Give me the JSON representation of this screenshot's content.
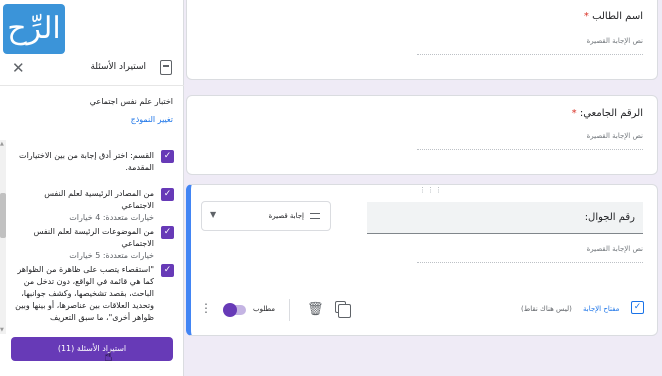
{
  "logo": {
    "text": "الرِّح"
  },
  "import_panel": {
    "title": "استيراد الأسئلة",
    "source_form": "اختبار علم نفس اجتماعي",
    "change_form_link": "تغيير النموذج",
    "questions": [
      {
        "text": "القسم: اختر أدق إجابة من بين الاختيارات المقدمة.",
        "sub": "",
        "checked": true
      },
      {
        "text": "من المصادر الرئيسية لعلم النفس الاجتماعي",
        "sub": "خيارات متعددة: 4 خيارات",
        "checked": true
      },
      {
        "text": "من الموضوعات الرئيسة لعلم النفس الاجتماعي",
        "sub": "خيارات متعددة: 5 خيارات",
        "checked": true
      },
      {
        "text": "\"استقصاء يتصب على ظاهرة من الظواهر كما هي قائمة في الواقع، دون تدخل من الباحث، بقصد تشخيصها، وكشف جوانبها، وتحديد العلاقات بين عناصرها، أو بينها وبين ظواهر أخرى\"، ما سبق التعريف",
        "sub": "",
        "checked": true
      }
    ],
    "import_button": "استيراد الأسئلة (11)"
  },
  "form": {
    "q1": {
      "label": "اسم الطالب",
      "required": "*",
      "placeholder": "نص الإجابة القصيرة"
    },
    "q2": {
      "label": "الرقم الجامعي:",
      "required": "*",
      "placeholder": "نص الإجابة القصيرة"
    },
    "q3": {
      "label": "رقم الجوال:",
      "placeholder": "نص الإجابة القصيرة",
      "type": "إجابة قصيرة",
      "answer_key": "مفتاح الإجابة",
      "points": "(ليس هناك نقاط)",
      "required_label": "مطلوب"
    }
  },
  "colors": {
    "accent": "#673ab7",
    "link": "#1a73e8",
    "active_border": "#4285f4"
  }
}
